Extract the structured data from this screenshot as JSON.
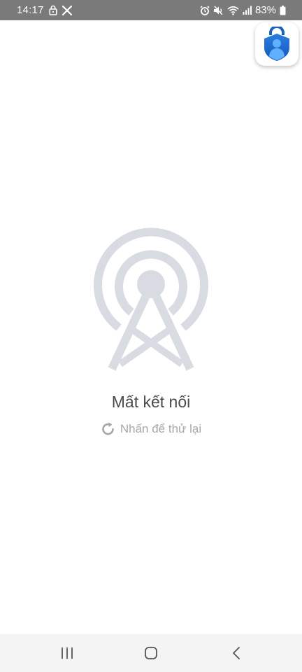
{
  "status_bar": {
    "time": "14:17",
    "battery_percent": "83%",
    "left_icons": [
      "lock-icon",
      "x-app-icon"
    ],
    "right_icons": [
      "alarm-icon",
      "mute-icon",
      "wifi-icon",
      "signal-icon",
      "battery-icon"
    ]
  },
  "app_badge": {
    "icon": "microsoft-authenticator-icon"
  },
  "connection_error": {
    "illustration": "broadcast-tower-icon",
    "title": "Mất kết nối",
    "retry_label": "Nhấn để thử lại",
    "retry_icon": "refresh-icon"
  },
  "nav_bar": {
    "buttons": [
      "recents-icon",
      "home-icon",
      "back-icon"
    ]
  },
  "colors": {
    "status_bar_bg": "#7a7a7a",
    "illustration": "#d9dbe3",
    "title_text": "#4a4a4a",
    "retry_text": "#a7a7ab",
    "nav_bar_bg": "#f4f4f4",
    "badge_blue": "#1f6fd1"
  }
}
